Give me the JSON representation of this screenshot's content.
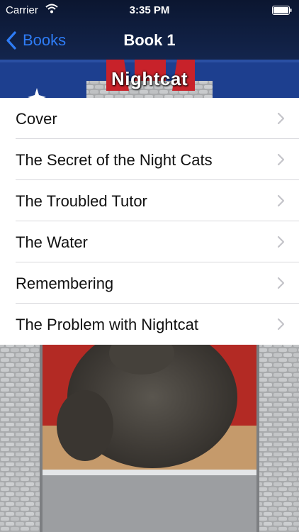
{
  "status_bar": {
    "carrier": "Carrier",
    "time": "3:35 PM",
    "wifi_icon": "wifi-icon",
    "battery_icon": "battery-icon"
  },
  "nav": {
    "back_label": "Books",
    "back_icon": "chevron-left-icon",
    "title": "Book 1"
  },
  "banner": {
    "title": "Nightcat"
  },
  "chapters": [
    {
      "label": "Cover"
    },
    {
      "label": "The Secret of the Night Cats"
    },
    {
      "label": "The Troubled Tutor"
    },
    {
      "label": "The Water"
    },
    {
      "label": "Remembering"
    },
    {
      "label": "The Problem with Nightcat"
    }
  ],
  "row_icon": "chevron-right-icon",
  "colors": {
    "tint": "#2e7cf6",
    "nav_background": "#0e1c3c",
    "banner_blue": "#1d3f8f",
    "banner_red": "#c8222a",
    "stone_gray": "#a7a9ab"
  }
}
